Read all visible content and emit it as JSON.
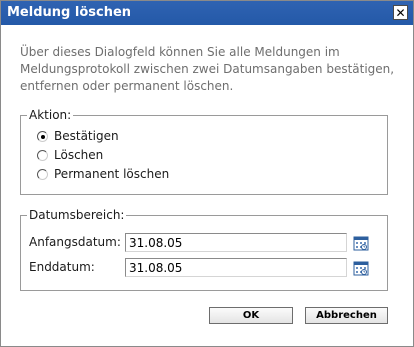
{
  "window": {
    "title": "Meldung löschen",
    "close_glyph": "✕"
  },
  "description": "Über dieses Dialogfeld können Sie alle Meldungen im Meldungsprotokoll zwischen zwei Datumsangaben bestätigen, entfernen oder permanent löschen.",
  "aktion": {
    "legend": "Aktion:",
    "options": [
      {
        "label": "Bestätigen",
        "selected": true
      },
      {
        "label": "Löschen",
        "selected": false
      },
      {
        "label": "Permanent löschen",
        "selected": false
      }
    ]
  },
  "datumsbereich": {
    "legend": "Datumsbereich:",
    "start_label": "Anfangsdatum:",
    "start_value": "31.08.05",
    "end_label": "Enddatum:",
    "end_value": "31.08.05",
    "calendar_icon": "calendar-icon"
  },
  "buttons": {
    "ok": "OK",
    "cancel": "Abbrechen"
  },
  "colors": {
    "titlebar": "#2459a8",
    "description_text": "#6e6e6e"
  }
}
